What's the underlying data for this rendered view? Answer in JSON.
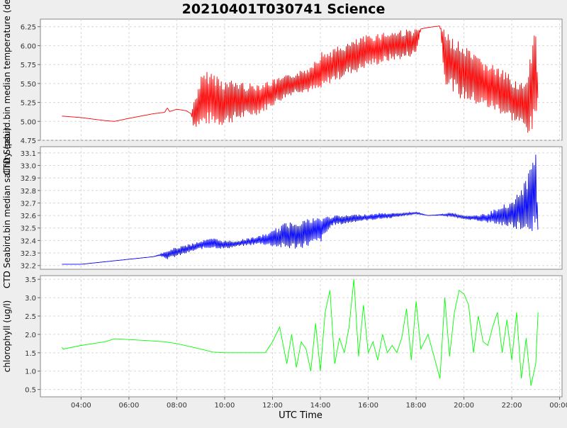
{
  "chart_data": {
    "type": "line",
    "title": "20210401T030741 Science",
    "xlabel": "UTC Time",
    "x_ticks": [
      "04:00",
      "06:00",
      "08:00",
      "10:00",
      "12:00",
      "14:00",
      "16:00",
      "18:00",
      "20:00",
      "22:00",
      "00:00"
    ],
    "x_range_hours": [
      2.3,
      24.1
    ],
    "grid": true,
    "panels": [
      {
        "ylabel": "CTD Seabird.bin median temperature (degC)",
        "ylim": [
          4.75,
          6.35
        ],
        "y_ticks": [
          4.75,
          5.0,
          5.25,
          5.5,
          5.75,
          6.0,
          6.25
        ],
        "color": "#ff0000",
        "series": {
          "x": [
            3.2,
            4.0,
            5.0,
            5.4,
            6.0,
            7.0,
            7.5,
            7.6,
            7.7,
            7.8,
            8.0,
            8.4,
            8.6,
            8.7,
            9.0,
            9.3,
            9.6,
            9.8,
            10.0,
            10.5,
            11.0,
            11.5,
            12.0,
            12.5,
            13.0,
            13.5,
            13.8,
            14.0,
            14.4,
            14.8,
            15.2,
            15.6,
            16.0,
            16.5,
            17.0,
            17.5,
            18.0,
            18.2,
            18.5,
            19.0,
            19.2,
            19.4,
            19.8,
            20.2,
            20.6,
            21.0,
            21.5,
            22.0,
            22.3,
            22.6,
            22.8,
            23.0,
            23.1
          ],
          "y": [
            5.07,
            5.05,
            5.01,
            5.0,
            5.04,
            5.1,
            5.12,
            5.18,
            5.13,
            5.14,
            5.16,
            5.14,
            5.1,
            5.05,
            5.2,
            5.35,
            5.4,
            5.3,
            5.3,
            5.33,
            5.25,
            5.22,
            5.3,
            5.42,
            5.5,
            5.62,
            5.75,
            5.85,
            5.7,
            5.8,
            5.9,
            5.7,
            5.8,
            5.85,
            5.9,
            5.9,
            5.88,
            6.22,
            6.24,
            6.26,
            6.0,
            5.85,
            5.75,
            5.7,
            5.6,
            5.55,
            5.45,
            5.4,
            5.3,
            5.2,
            5.1,
            5.3,
            5.4
          ]
        },
        "y_low": [
          5.07,
          5.05,
          5.01,
          5.0,
          5.04,
          5.1,
          5.12,
          5.18,
          5.13,
          5.14,
          5.16,
          5.14,
          5.1,
          4.92,
          4.92,
          4.95,
          4.95,
          4.93,
          4.95,
          5.0,
          5.05,
          5.1,
          5.2,
          5.3,
          5.38,
          5.38,
          5.38,
          5.38,
          5.5,
          5.55,
          5.62,
          5.65,
          5.72,
          5.75,
          5.8,
          5.82,
          5.88,
          6.22,
          6.24,
          6.26,
          5.5,
          5.45,
          5.3,
          5.25,
          5.2,
          5.15,
          5.1,
          5.0,
          4.95,
          4.85,
          4.8,
          4.9,
          5.35
        ],
        "y_high": [
          5.07,
          5.05,
          5.01,
          5.0,
          5.04,
          5.1,
          5.12,
          5.18,
          5.13,
          5.14,
          5.16,
          5.14,
          5.1,
          5.25,
          5.6,
          5.67,
          5.65,
          5.6,
          5.55,
          5.55,
          5.5,
          5.52,
          5.55,
          5.6,
          5.65,
          5.72,
          5.85,
          5.92,
          5.95,
          6.0,
          6.05,
          6.1,
          6.15,
          6.18,
          6.2,
          6.22,
          6.22,
          6.22,
          6.24,
          6.26,
          6.2,
          6.15,
          6.05,
          5.95,
          5.85,
          5.8,
          5.7,
          5.6,
          5.55,
          5.5,
          5.9,
          6.35,
          5.4
        ]
      },
      {
        "ylabel": "CTD Seabird.bin median salinity (psu)",
        "ylim": [
          32.17,
          33.15
        ],
        "y_ticks": [
          32.2,
          32.3,
          32.4,
          32.5,
          32.6,
          32.7,
          32.8,
          32.9,
          33.0,
          33.1
        ],
        "color": "#0000ff",
        "series": {
          "x": [
            3.2,
            4.0,
            5.0,
            6.0,
            7.0,
            7.3,
            7.6,
            8.0,
            8.5,
            9.0,
            9.5,
            10.0,
            10.5,
            11.0,
            11.5,
            12.0,
            12.5,
            13.0,
            13.5,
            14.0,
            14.5,
            15.0,
            15.5,
            16.0,
            16.5,
            17.0,
            17.5,
            18.0,
            18.5,
            19.0,
            19.5,
            20.0,
            20.5,
            21.0,
            21.5,
            22.0,
            22.5,
            22.8,
            23.0,
            23.1
          ],
          "y": [
            32.21,
            32.21,
            32.23,
            32.25,
            32.27,
            32.28,
            32.3,
            32.32,
            32.35,
            32.38,
            32.37,
            32.37,
            32.38,
            32.39,
            32.4,
            32.43,
            32.47,
            32.5,
            32.52,
            32.55,
            32.56,
            32.57,
            32.58,
            32.58,
            32.59,
            32.6,
            32.61,
            32.62,
            32.6,
            32.6,
            32.61,
            32.59,
            32.58,
            32.57,
            32.56,
            32.55,
            32.52,
            32.5,
            32.5,
            32.47
          ]
        },
        "y_low": [
          32.21,
          32.21,
          32.23,
          32.25,
          32.27,
          32.28,
          32.25,
          32.27,
          32.3,
          32.33,
          32.34,
          32.33,
          32.35,
          32.36,
          32.37,
          32.35,
          32.33,
          32.33,
          32.35,
          32.38,
          32.52,
          32.53,
          32.55,
          32.56,
          32.57,
          32.58,
          32.6,
          32.61,
          32.6,
          32.6,
          32.59,
          32.57,
          32.56,
          32.54,
          32.52,
          32.5,
          32.48,
          32.47,
          32.46,
          32.47
        ],
        "y_high": [
          32.21,
          32.21,
          32.23,
          32.25,
          32.27,
          32.29,
          32.32,
          32.35,
          32.37,
          32.4,
          32.42,
          32.4,
          32.4,
          32.42,
          32.44,
          32.48,
          32.54,
          32.57,
          32.58,
          32.59,
          32.6,
          32.6,
          32.61,
          32.61,
          32.62,
          32.62,
          32.62,
          32.63,
          32.6,
          32.61,
          32.62,
          32.6,
          32.6,
          32.62,
          32.68,
          32.72,
          32.85,
          33.0,
          33.12,
          32.5
        ]
      },
      {
        "ylabel": "chlorophyll (ug/l)",
        "ylim": [
          0.3,
          3.6
        ],
        "y_ticks": [
          0.5,
          1.0,
          1.5,
          2.0,
          2.5,
          3.0,
          3.5
        ],
        "color": "#00ff00",
        "series": {
          "x": [
            3.2,
            3.25,
            4.0,
            5.0,
            5.4,
            6.0,
            6.5,
            7.0,
            7.5,
            8.0,
            9.0,
            9.5,
            10.0,
            11.0,
            11.7,
            12.0,
            12.3,
            12.6,
            12.8,
            13.0,
            13.2,
            13.4,
            13.6,
            13.8,
            14.0,
            14.2,
            14.4,
            14.6,
            14.8,
            15.0,
            15.2,
            15.4,
            15.6,
            15.8,
            16.0,
            16.2,
            16.4,
            16.6,
            16.8,
            17.0,
            17.2,
            17.4,
            17.6,
            17.8,
            18.0,
            18.2,
            18.5,
            19.0,
            19.2,
            19.4,
            19.6,
            19.8,
            20.0,
            20.2,
            20.4,
            20.6,
            20.8,
            21.0,
            21.2,
            21.4,
            21.6,
            21.8,
            22.0,
            22.2,
            22.4,
            22.6,
            22.8,
            23.0,
            23.1
          ],
          "y": [
            1.65,
            1.6,
            1.7,
            1.8,
            1.88,
            1.86,
            1.84,
            1.82,
            1.8,
            1.75,
            1.6,
            1.52,
            1.5,
            1.5,
            1.5,
            1.8,
            2.2,
            1.2,
            2.0,
            1.1,
            1.8,
            1.6,
            1.0,
            2.3,
            1.0,
            2.6,
            3.2,
            1.2,
            1.9,
            1.5,
            2.2,
            3.5,
            1.4,
            2.8,
            1.5,
            1.8,
            1.3,
            2.0,
            1.5,
            1.7,
            1.5,
            1.9,
            2.7,
            1.3,
            2.9,
            1.6,
            2.0,
            0.8,
            3.0,
            1.4,
            2.6,
            3.2,
            3.1,
            2.8,
            1.5,
            2.5,
            1.8,
            1.7,
            2.2,
            2.6,
            1.5,
            2.4,
            1.3,
            2.6,
            0.8,
            1.9,
            0.6,
            1.2,
            2.6
          ]
        }
      }
    ]
  }
}
